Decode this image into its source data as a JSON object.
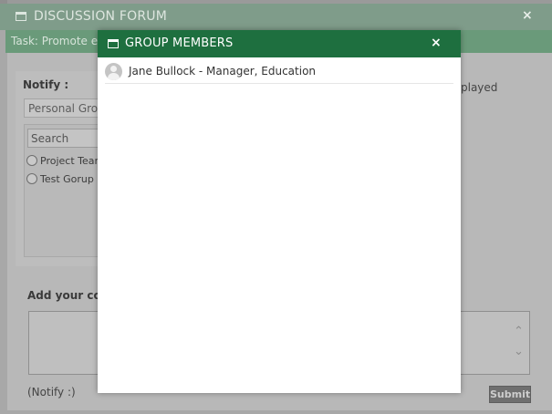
{
  "forum": {
    "title": "DISCUSSION FORUM",
    "close_symbol": "×",
    "task_text": "Task: Promote effi",
    "notify_label": "Notify :",
    "group_select_value": "Personal Group",
    "search_placeholder": "Search",
    "groups": [
      {
        "label": "Project Team"
      },
      {
        "label": "Test Gorup"
      }
    ],
    "displayed_fragment": "played",
    "comment_label": "Add your com",
    "notify_footer": "(Notify :)",
    "submit_label": "Submit",
    "scroll_up_symbol": "⌃",
    "scroll_down_symbol": "⌄"
  },
  "modal": {
    "title": "GROUP MEMBERS",
    "close_symbol": "×",
    "members": [
      {
        "name": "Jane Bullock - Manager, Education"
      }
    ]
  },
  "icons": {
    "window": "window-icon",
    "close": "close-icon",
    "avatar": "user-avatar-icon"
  },
  "colors": {
    "modal_header": "#1e6f3f",
    "forum_header_dimmed": "#7f9c8a",
    "task_bar_dimmed": "#6a9a7a"
  }
}
